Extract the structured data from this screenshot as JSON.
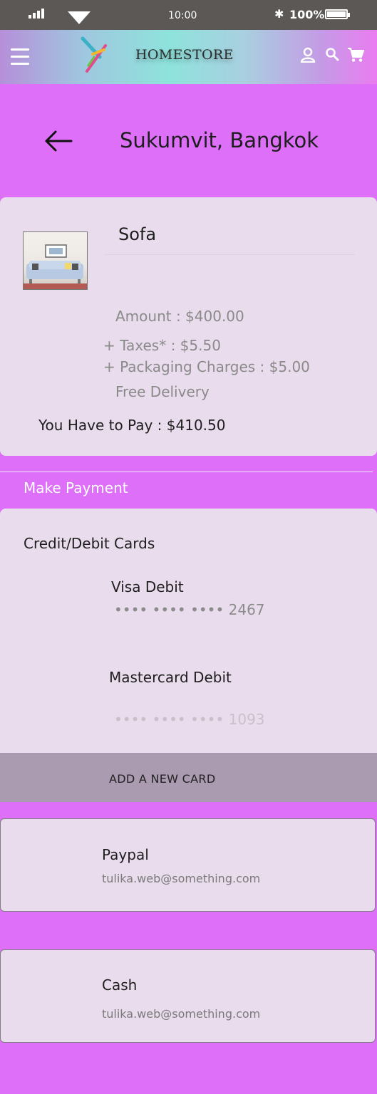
{
  "status": {
    "time": "10:00",
    "battery": "100%",
    "bluetooth_icon": "bluetooth-icon"
  },
  "header": {
    "brand": "HOMESTORE",
    "menu_icon": "hamburger-icon",
    "user_icon": "user-icon",
    "search_icon": "search-icon",
    "cart_icon": "cart-icon"
  },
  "location": {
    "title": "Sukumvit, Bangkok",
    "back_icon": "back-arrow-icon"
  },
  "order": {
    "product": "Sofa",
    "amount": "Amount : $400.00",
    "taxes": "+ Taxes* : $5.50",
    "packaging": "+ Packaging Charges : $5.00",
    "delivery": "Free Delivery",
    "total": "You Have to Pay : $410.50"
  },
  "payment": {
    "section_title": "Make Payment",
    "cards_title": "Credit/Debit Cards",
    "cards": [
      {
        "name": "Visa Debit",
        "number": "•••• •••• •••• 2467"
      },
      {
        "name": "Mastercard Debit",
        "number": "•••• •••• •••• 1093"
      }
    ],
    "add_card": "ADD A NEW CARD",
    "paypal": {
      "title": "Paypal",
      "email": "tulika.web@something.com"
    },
    "cash": {
      "title": "Cash",
      "email": "tulika.web@something.com"
    }
  },
  "colors": {
    "background": "#dd6ff9",
    "panel": "#e9dcec",
    "add_card_bar": "#ab9bb0",
    "status_bar": "#5c5856"
  }
}
